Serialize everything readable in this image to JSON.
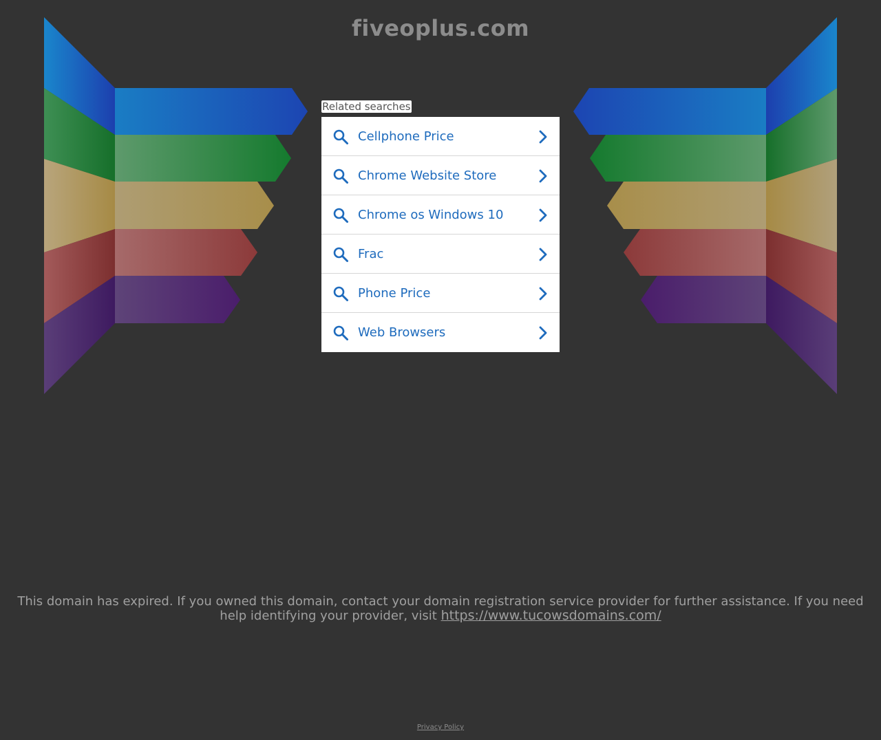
{
  "domain": "fiveoplus.com",
  "related": {
    "label": "Related searches",
    "items": [
      {
        "label": "Cellphone Price"
      },
      {
        "label": "Chrome Website Store"
      },
      {
        "label": "Chrome os Windows 10"
      },
      {
        "label": "Frac"
      },
      {
        "label": "Phone Price"
      },
      {
        "label": "Web Browsers"
      }
    ]
  },
  "notice": {
    "text": "This domain has expired. If you owned this domain, contact your domain registration service provider for further assistance. If you need help identifying your provider, visit",
    "link": "https://www.tucowsdomains.com/"
  },
  "footer": {
    "privacy_label": "Privacy Policy"
  },
  "colors": {
    "background": "#333333",
    "link_blue": "#1e6bbd",
    "stripe_blue": "#1a4fb0",
    "stripe_green": "#1e7a35",
    "stripe_gold": "#a88f4f",
    "stripe_red": "#8e4040",
    "stripe_purple": "#4a2266"
  }
}
